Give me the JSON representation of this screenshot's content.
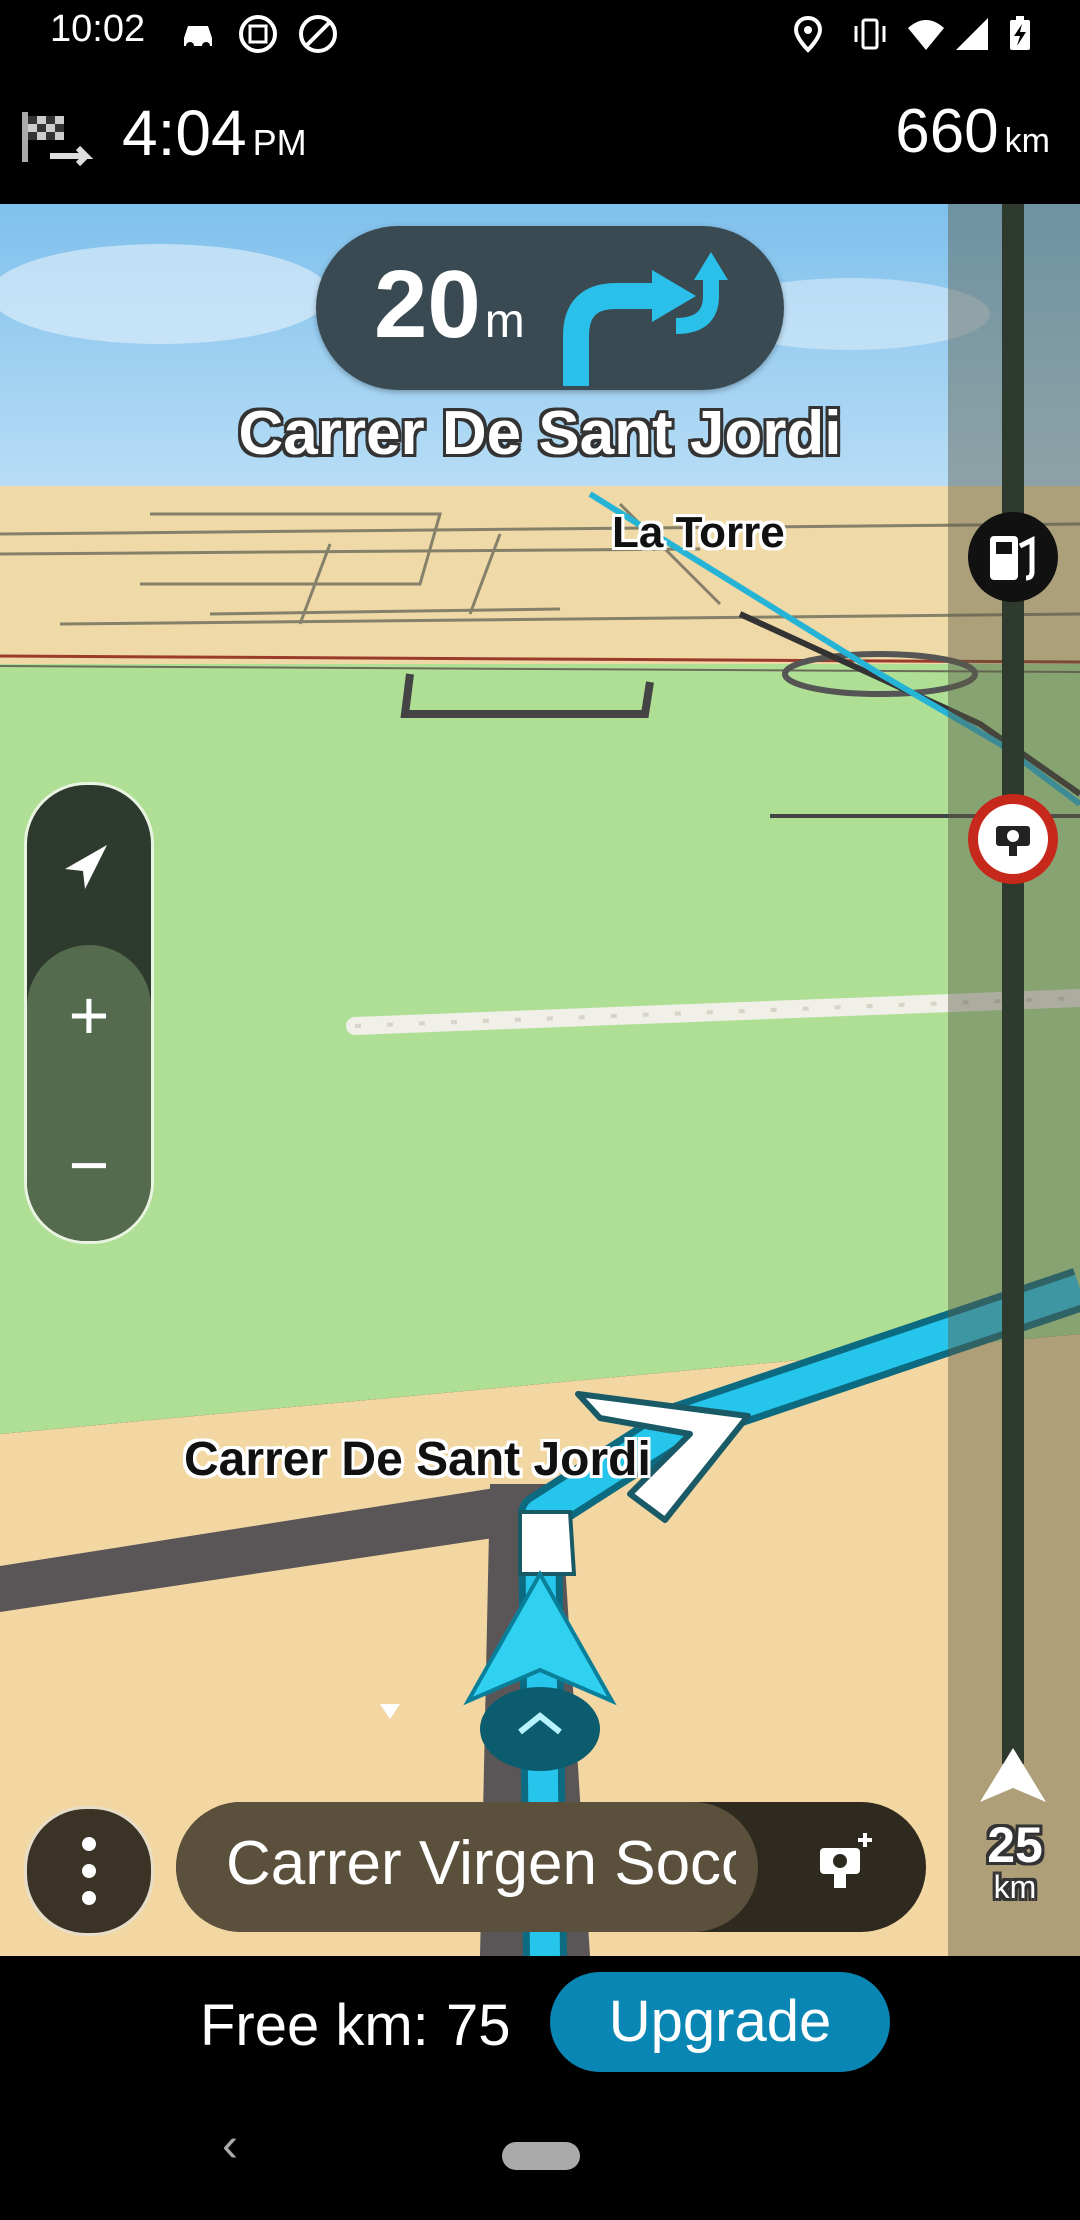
{
  "status_bar": {
    "time": "10:02",
    "left_icons": [
      "car-icon",
      "screenshot-icon",
      "no-tracking-icon"
    ],
    "right_icons": [
      "location-icon",
      "vibrate-icon",
      "wifi-icon",
      "signal-icon",
      "battery-icon"
    ]
  },
  "eta_bar": {
    "arrival_time": "4:04",
    "arrival_ampm": "PM",
    "distance_remaining": "660",
    "distance_unit": "km"
  },
  "instruction": {
    "distance": "20",
    "unit": "m",
    "next_street": "Carrer De Sant Jordi"
  },
  "map": {
    "place_label": "La Torre",
    "road_label": "Carrer De Sant Jordi",
    "colors": {
      "sky": "#8fc7ec",
      "grass": "#aedf95",
      "sand": "#f3d7a2",
      "route": "#26c6ec",
      "road": "#5a5a5a"
    }
  },
  "zoom": {
    "in_label": "+",
    "out_label": "−"
  },
  "route_bar": {
    "distance": "25",
    "unit": "km"
  },
  "bottom_panel": {
    "current_street": "Carrer Virgen Soco"
  },
  "upgrade": {
    "free_km_label": "Free km:",
    "free_km_value": "75",
    "button_label": "Upgrade",
    "accent": "#0a86b5"
  },
  "nav": {
    "back_glyph": "‹"
  }
}
